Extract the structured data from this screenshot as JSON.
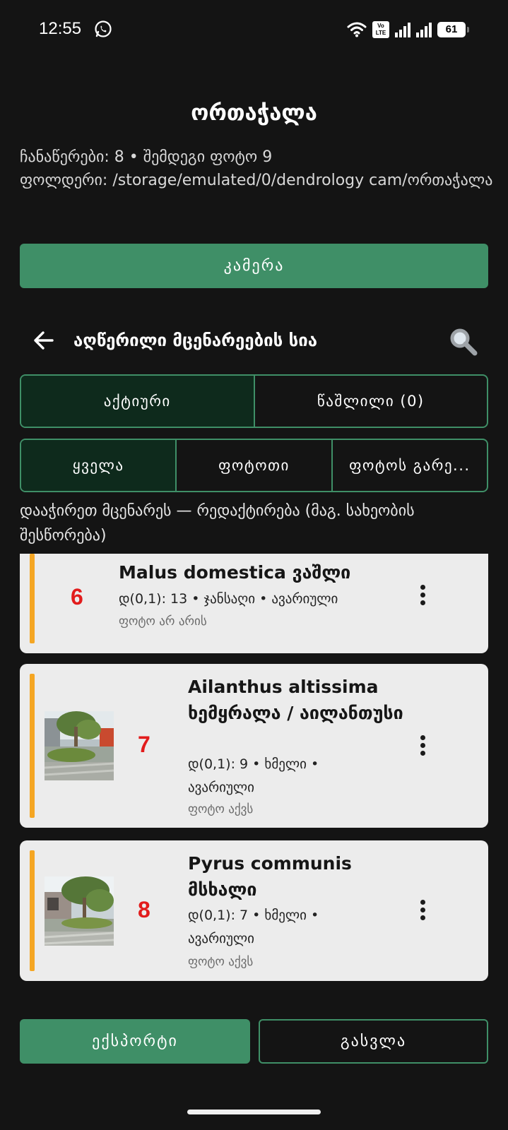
{
  "status_bar": {
    "time": "12:55",
    "volte": "Vo LTE",
    "battery": "61"
  },
  "header": {
    "title": "ორთაჭალა",
    "records_line": "ჩანაწერები: 8 • შემდეგი ფოტო 9",
    "folder_line": "ფოლდერი: /storage/emulated/0/dendrology cam/ორთაჭალა"
  },
  "camera_button": "კამერა",
  "list_header": {
    "title": "აღწერილი მცენარეების სია"
  },
  "status_tabs": [
    {
      "label": "აქტიური",
      "active": true
    },
    {
      "label": "წაშლილი (0)",
      "active": false
    }
  ],
  "filter_tabs": [
    {
      "label": "ყველა",
      "active": true
    },
    {
      "label": "ფოტოთი",
      "active": false
    },
    {
      "label": "ფოტოს გარე...",
      "active": false
    }
  ],
  "hint": "დააჭირეთ მცენარეს — რედაქტირება (მაგ. სახეობის შესწორება)",
  "plants": [
    {
      "number": "6",
      "name": "Malus domestica ვაშლი",
      "meta": "დ(0,1): 13 • ჯანსაღი • ავარიული",
      "photo": "ფოტო არ არის",
      "has_photo": false
    },
    {
      "number": "7",
      "name": "Ailanthus altissima ხემყრალა / აილანთუსი",
      "meta": "დ(0,1): 9 • ხმელი • ავარიული",
      "photo": "ფოტო აქვს",
      "has_photo": true
    },
    {
      "number": "8",
      "name": "Pyrus communis მსხალი",
      "meta": "დ(0,1): 7 • ხმელი • ავარიული",
      "photo": "ფოტო აქვს",
      "has_photo": true
    }
  ],
  "bottom": {
    "export": "ექსპორტი",
    "exit": "გასვლა"
  },
  "colors": {
    "accent": "#3f8f67",
    "number": "#e21c1c",
    "stripe": "#f5a623",
    "background": "#141414",
    "card": "#ececec"
  },
  "icons": [
    "whatsapp-icon",
    "wifi-icon",
    "signal-icon",
    "battery-icon",
    "back-arrow-icon",
    "search-icon",
    "more-vert-icon"
  ]
}
